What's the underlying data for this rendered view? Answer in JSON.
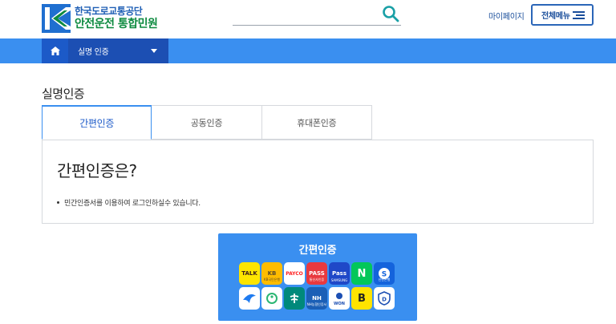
{
  "header": {
    "logo_line1": "한국도로교통공단",
    "logo_line2": "안전운전 통합민원",
    "search_placeholder": "",
    "mypage_label": "마이페이지",
    "allmenu_label": "전체메뉴"
  },
  "nav": {
    "current_menu": "실명 인증"
  },
  "page": {
    "title": "실명인증",
    "tabs": [
      {
        "label": "간편인증",
        "active": true
      },
      {
        "label": "공동인증",
        "active": false
      },
      {
        "label": "휴대폰인증",
        "active": false
      }
    ],
    "content_heading": "간편인증은?",
    "content_bullet": "민간인증서를 이용하여 로그인하실수 있습니다."
  },
  "auth": {
    "title": "간편인증",
    "icons_row1": [
      {
        "name": "kakao-icon",
        "label": "TALK",
        "bg": "#fde500",
        "fg": "#3b1e1e"
      },
      {
        "name": "kb-icon",
        "label": "KB",
        "sub": "KB국민은행",
        "bg": "#ffbc00",
        "fg": "#5a4a2a"
      },
      {
        "name": "payco-icon",
        "label": "PAYCO",
        "bg": "#ffffff",
        "fg": "#ff1f1f"
      },
      {
        "name": "pass-icon",
        "label": "PASS",
        "sub": "통신사인증",
        "bg": "#e8393f",
        "fg": "#ffffff"
      },
      {
        "name": "samsung-pass-icon",
        "label": "Pass",
        "sub": "SAMSUNG",
        "bg": "#1f48c8",
        "fg": "#ffffff"
      },
      {
        "name": "naver-icon",
        "label": "N",
        "bg": "#03c75a",
        "fg": "#ffffff"
      },
      {
        "name": "shinhan-icon",
        "label": "S",
        "sub": "신한은행",
        "bg": "#1463dc",
        "fg": "#ffffff"
      }
    ],
    "icons_row2": [
      {
        "name": "toss-icon",
        "label": "",
        "bg": "#ffffff",
        "fg": "#1f7bf0"
      },
      {
        "name": "nice-icon",
        "label": "",
        "bg": "#ffffff",
        "fg": "#2bb673"
      },
      {
        "name": "hana-icon",
        "label": "",
        "sub": "하나은행",
        "bg": "#00897b",
        "fg": "#ffffff"
      },
      {
        "name": "nh-icon",
        "label": "NH",
        "sub": "NH농협인증서",
        "bg": "#1b5fb6",
        "fg": "#ffffff"
      },
      {
        "name": "woori-icon",
        "label": "WON",
        "bg": "#ffffff",
        "fg": "#1c4fb3"
      },
      {
        "name": "bank-b-icon",
        "label": "B",
        "bg": "#ffe300",
        "fg": "#222222"
      },
      {
        "name": "shield-d-icon",
        "label": "D",
        "bg": "#ffffff",
        "fg": "#1c4fb3"
      }
    ]
  }
}
